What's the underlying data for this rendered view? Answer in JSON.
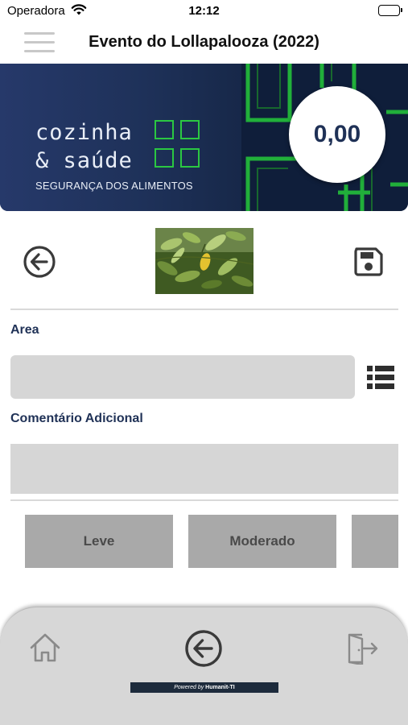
{
  "status_bar": {
    "carrier": "Operadora",
    "time": "12:12",
    "wifi_icon": "wifi-icon",
    "battery_icon": "battery-icon"
  },
  "nav": {
    "title": "Evento do Lollapalooza (2022)",
    "menu_icon": "hamburger-menu-icon"
  },
  "banner": {
    "brand_line1": "cozinha",
    "brand_line2": "& saúde",
    "brand_subtitle": "SEGURANÇA DOS ALIMENTOS",
    "score": "0,00",
    "colors": {
      "navy": "#1f3156",
      "green": "#2bc742"
    }
  },
  "actions": {
    "back_icon": "arrow-left-circle-icon",
    "photo": "plant-photo",
    "save_icon": "floppy-disk-icon"
  },
  "form": {
    "area_label": "Area",
    "area_value": "",
    "list_icon": "list-icon",
    "comment_label": "Comentário Adicional",
    "comment_value": ""
  },
  "severity": {
    "options": [
      "Leve",
      "Moderado",
      ""
    ]
  },
  "bottom_bar": {
    "home_icon": "home-icon",
    "back_icon": "arrow-left-circle-icon",
    "exit_icon": "exit-door-icon",
    "powered_prefix": "Powered by",
    "powered_brand": "Humanit-TI"
  }
}
